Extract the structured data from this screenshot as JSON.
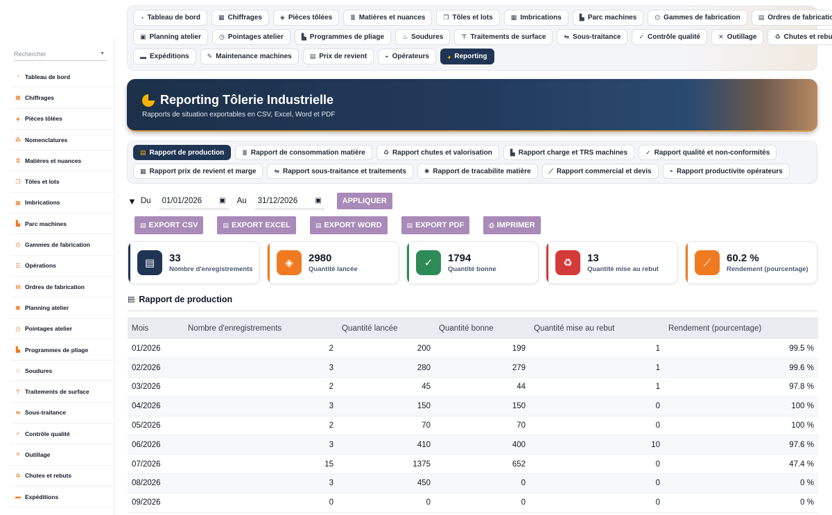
{
  "sidebar": {
    "search_placeholder": "Rechercher",
    "items": [
      {
        "label": "Tableau de bord",
        "icon": "dashboard-icon",
        "glyph": "◔"
      },
      {
        "label": "Chiffrages",
        "icon": "calculator-icon",
        "glyph": "▦"
      },
      {
        "label": "Pièces tôlées",
        "icon": "cube-icon",
        "glyph": "◈"
      },
      {
        "label": "Nomenclatures",
        "icon": "sitemap-icon",
        "glyph": "⁂"
      },
      {
        "label": "Matières et nuances",
        "icon": "layers-icon",
        "glyph": "≣"
      },
      {
        "label": "Tôles et lots",
        "icon": "copy-icon",
        "glyph": "❐"
      },
      {
        "label": "Imbrications",
        "icon": "grid-icon",
        "glyph": "▦"
      },
      {
        "label": "Parc machines",
        "icon": "factory-icon",
        "glyph": "▙"
      },
      {
        "label": "Gammes de fabrication",
        "icon": "route-icon",
        "glyph": "⌬"
      },
      {
        "label": "Opérations",
        "icon": "list-icon",
        "glyph": "☰"
      },
      {
        "label": "Ordres de fabrication",
        "icon": "clipboard-icon",
        "glyph": "▤"
      },
      {
        "label": "Planning atelier",
        "icon": "calendar-icon",
        "glyph": "▣"
      },
      {
        "label": "Pointages atelier",
        "icon": "clock-icon",
        "glyph": "◷"
      },
      {
        "label": "Programmes de pliage",
        "icon": "chart-icon",
        "glyph": "▙"
      },
      {
        "label": "Soudures",
        "icon": "fire-icon",
        "glyph": "♨"
      },
      {
        "label": "Traitements de surface",
        "icon": "paint-roller-icon",
        "glyph": "⊤"
      },
      {
        "label": "Sous-traitance",
        "icon": "handshake-icon",
        "glyph": "⇋"
      },
      {
        "label": "Contrôle qualité",
        "icon": "check-double-icon",
        "glyph": "✓"
      },
      {
        "label": "Outillage",
        "icon": "tools-icon",
        "glyph": "✕"
      },
      {
        "label": "Chutes et rebuts",
        "icon": "recycle-icon",
        "glyph": "♻"
      },
      {
        "label": "Expéditions",
        "icon": "truck-icon",
        "glyph": "▬"
      }
    ]
  },
  "topnav": {
    "rows": [
      [
        {
          "label": "Tableau de bord",
          "icon": "dashboard-icon",
          "glyph": "◔"
        },
        {
          "label": "Chiffrages",
          "icon": "calculator-icon",
          "glyph": "▦"
        },
        {
          "label": "Pièces tôlées",
          "icon": "cube-icon",
          "glyph": "◈"
        },
        {
          "label": "Matières et nuances",
          "icon": "layers-icon",
          "glyph": "≣"
        },
        {
          "label": "Tôles et lots",
          "icon": "copy-icon",
          "glyph": "❐"
        },
        {
          "label": "Imbrications",
          "icon": "grid-icon",
          "glyph": "▦"
        },
        {
          "label": "Parc machines",
          "icon": "factory-icon",
          "glyph": "▙"
        },
        {
          "label": "Gammes de fabrication",
          "icon": "route-icon",
          "glyph": "⌬"
        },
        {
          "label": "Ordres de fabrication",
          "icon": "clipboard-icon",
          "glyph": "▤"
        }
      ],
      [
        {
          "label": "Planning atelier",
          "icon": "calendar-icon",
          "glyph": "▣"
        },
        {
          "label": "Pointages atelier",
          "icon": "clock-icon",
          "glyph": "◷"
        },
        {
          "label": "Programmes de pliage",
          "icon": "chart-icon",
          "glyph": "▙"
        },
        {
          "label": "Soudures",
          "icon": "fire-icon",
          "glyph": "♨"
        },
        {
          "label": "Traitements de surface",
          "icon": "paint-roller-icon",
          "glyph": "⊤"
        },
        {
          "label": "Sous-traitance",
          "icon": "handshake-icon",
          "glyph": "⇋"
        },
        {
          "label": "Contrôle qualité",
          "icon": "check-double-icon",
          "glyph": "✓"
        },
        {
          "label": "Outillage",
          "icon": "tools-icon",
          "glyph": "✕"
        },
        {
          "label": "Chutes et rebuts",
          "icon": "recycle-icon",
          "glyph": "♻"
        }
      ],
      [
        {
          "label": "Expéditions",
          "icon": "truck-icon",
          "glyph": "▬"
        },
        {
          "label": "Maintenance machines",
          "icon": "wrench-icon",
          "glyph": "✎"
        },
        {
          "label": "Prix de revient",
          "icon": "receipt-icon",
          "glyph": "▤"
        },
        {
          "label": "Opérateurs",
          "icon": "hard-hat-icon",
          "glyph": "◓"
        },
        {
          "label": "Reporting",
          "icon": "pie-chart-icon",
          "glyph": "◕",
          "active": true
        }
      ]
    ]
  },
  "banner": {
    "title": "Reporting Tôlerie Industrielle",
    "subtitle": "Rapports de situation exportables en CSV, Excel, Word et PDF"
  },
  "report_tabs": {
    "rows": [
      [
        {
          "label": "Rapport de production",
          "icon": "clipboard-icon",
          "glyph": "▤",
          "active": true
        },
        {
          "label": "Rapport de consommation matière",
          "icon": "layers-icon",
          "glyph": "≣"
        },
        {
          "label": "Rapport chutes et valorisation",
          "icon": "recycle-icon",
          "glyph": "♻"
        },
        {
          "label": "Rapport charge et TRS machines",
          "icon": "factory-icon",
          "glyph": "▙"
        },
        {
          "label": "Rapport qualité et non-conformités",
          "icon": "check-double-icon",
          "glyph": "✓"
        }
      ],
      [
        {
          "label": "Rapport prix de revient et marge",
          "icon": "calculator-icon",
          "glyph": "▦"
        },
        {
          "label": "Rapport sous-traitance et traitements",
          "icon": "handshake-icon",
          "glyph": "⇋"
        },
        {
          "label": "Rapport de tracabilite matière",
          "icon": "cog-icon",
          "glyph": "✱"
        },
        {
          "label": "Rapport commercial et devis",
          "icon": "line-chart-icon",
          "glyph": "⟋"
        },
        {
          "label": "Rapport productivite opérateurs",
          "icon": "hard-hat-icon",
          "glyph": "◓"
        }
      ]
    ]
  },
  "filters": {
    "from_label": "Du",
    "from_value": "01/01/2026",
    "to_label": "Au",
    "to_value": "31/12/2026",
    "apply_label": "APPLIQUER"
  },
  "exports": [
    {
      "label": "EXPORT CSV",
      "icon": "file-csv-icon"
    },
    {
      "label": "EXPORT EXCEL",
      "icon": "file-excel-icon"
    },
    {
      "label": "EXPORT WORD",
      "icon": "file-word-icon"
    },
    {
      "label": "EXPORT PDF",
      "icon": "file-pdf-icon"
    },
    {
      "label": "IMPRIMER",
      "icon": "print-icon"
    }
  ],
  "kpis": [
    {
      "value": "33",
      "label": "Nombre d'enregistrements",
      "icon": "clipboard-list-icon",
      "glyph": "▤",
      "color": "#1f3553"
    },
    {
      "value": "2980",
      "label": "Quantité lancée",
      "icon": "box-icon",
      "glyph": "◈",
      "color": "#f07a22"
    },
    {
      "value": "1794",
      "label": "Quantité bonne",
      "icon": "check-icon",
      "glyph": "✓",
      "color": "#2e8b57"
    },
    {
      "value": "13",
      "label": "Quantité mise au rebut",
      "icon": "recycle-icon",
      "glyph": "♻",
      "color": "#d33a3a"
    },
    {
      "value": "60.2 %",
      "label": "Rendement (pourcentage)",
      "icon": "trend-chart-icon",
      "glyph": "⟋",
      "color": "#f07a22"
    }
  ],
  "section": {
    "title": "Rapport de production",
    "icon": "clipboard-icon"
  },
  "table": {
    "columns": [
      "Mois",
      "Nombre d'enregistrements",
      "Quantité lancée",
      "Quantité bonne",
      "Quantité mise au rebut",
      "Rendement (pourcentage)"
    ],
    "rows": [
      [
        "01/2026",
        "2",
        "200",
        "199",
        "1",
        "99.5 %"
      ],
      [
        "02/2026",
        "3",
        "280",
        "279",
        "1",
        "99.6 %"
      ],
      [
        "03/2026",
        "2",
        "45",
        "44",
        "1",
        "97.8 %"
      ],
      [
        "04/2026",
        "3",
        "150",
        "150",
        "0",
        "100 %"
      ],
      [
        "05/2026",
        "2",
        "70",
        "70",
        "0",
        "100 %"
      ],
      [
        "06/2026",
        "3",
        "410",
        "400",
        "10",
        "97.6 %"
      ],
      [
        "07/2026",
        "15",
        "1375",
        "652",
        "0",
        "47.4 %"
      ],
      [
        "08/2026",
        "3",
        "450",
        "0",
        "0",
        "0 %"
      ],
      [
        "09/2026",
        "0",
        "0",
        "0",
        "0",
        "0 %"
      ]
    ]
  }
}
